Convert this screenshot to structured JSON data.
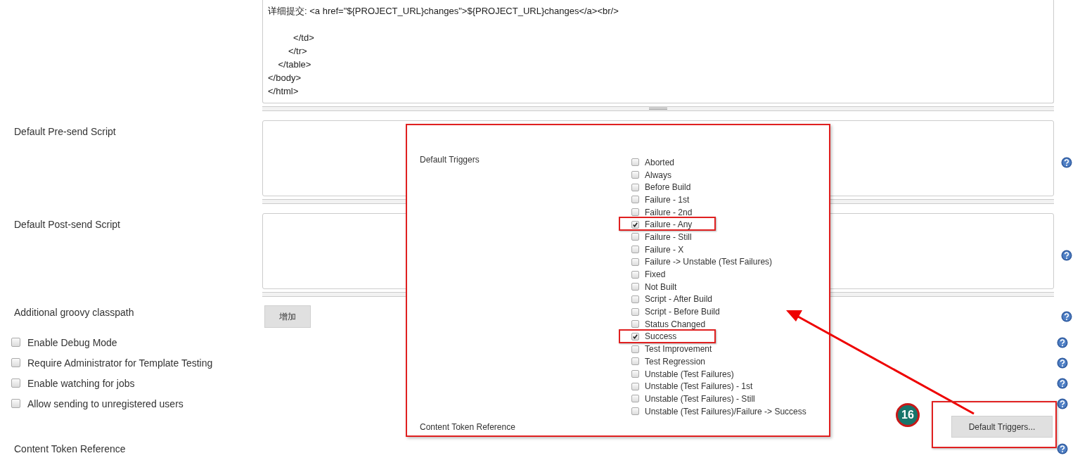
{
  "editor": {
    "content": "详细提交: <a href=\"${PROJECT_URL}changes\">${PROJECT_URL}changes</a><br/>\n\n          </td>\n        </tr>\n    </table>\n</body>\n</html>"
  },
  "script_fields": [
    {
      "label": "Default Pre-send Script"
    },
    {
      "label": "Default Post-send Script"
    }
  ],
  "classpath": {
    "label": "Additional groovy classpath",
    "button": "增加"
  },
  "options": [
    {
      "label": "Enable Debug Mode",
      "checked": false
    },
    {
      "label": "Require Administrator for Template Testing",
      "checked": false
    },
    {
      "label": "Enable watching for jobs",
      "checked": false
    },
    {
      "label": "Allow sending to unregistered users",
      "checked": false
    }
  ],
  "triggers_button": "Default Triggers...",
  "content_token_label": "Content Token Reference",
  "popup": {
    "label": "Default Triggers",
    "footer_label": "Content Token Reference",
    "triggers": [
      {
        "label": "Aborted",
        "checked": false,
        "highlighted": false
      },
      {
        "label": "Always",
        "checked": false,
        "highlighted": false
      },
      {
        "label": "Before Build",
        "checked": false,
        "highlighted": false
      },
      {
        "label": "Failure - 1st",
        "checked": false,
        "highlighted": false
      },
      {
        "label": "Failure - 2nd",
        "checked": false,
        "highlighted": false
      },
      {
        "label": "Failure - Any",
        "checked": true,
        "highlighted": true
      },
      {
        "label": "Failure - Still",
        "checked": false,
        "highlighted": false
      },
      {
        "label": "Failure - X",
        "checked": false,
        "highlighted": false
      },
      {
        "label": "Failure -> Unstable (Test Failures)",
        "checked": false,
        "highlighted": false
      },
      {
        "label": "Fixed",
        "checked": false,
        "highlighted": false
      },
      {
        "label": "Not Built",
        "checked": false,
        "highlighted": false
      },
      {
        "label": "Script - After Build",
        "checked": false,
        "highlighted": false
      },
      {
        "label": "Script - Before Build",
        "checked": false,
        "highlighted": false
      },
      {
        "label": "Status Changed",
        "checked": false,
        "highlighted": false
      },
      {
        "label": "Success",
        "checked": true,
        "highlighted": true
      },
      {
        "label": "Test Improvement",
        "checked": false,
        "highlighted": false
      },
      {
        "label": "Test Regression",
        "checked": false,
        "highlighted": false
      },
      {
        "label": "Unstable (Test Failures)",
        "checked": false,
        "highlighted": false
      },
      {
        "label": "Unstable (Test Failures) - 1st",
        "checked": false,
        "highlighted": false
      },
      {
        "label": "Unstable (Test Failures) - Still",
        "checked": false,
        "highlighted": false
      },
      {
        "label": "Unstable (Test Failures)/Failure -> Success",
        "checked": false,
        "highlighted": false
      }
    ]
  },
  "annotation": {
    "badge": "16"
  }
}
